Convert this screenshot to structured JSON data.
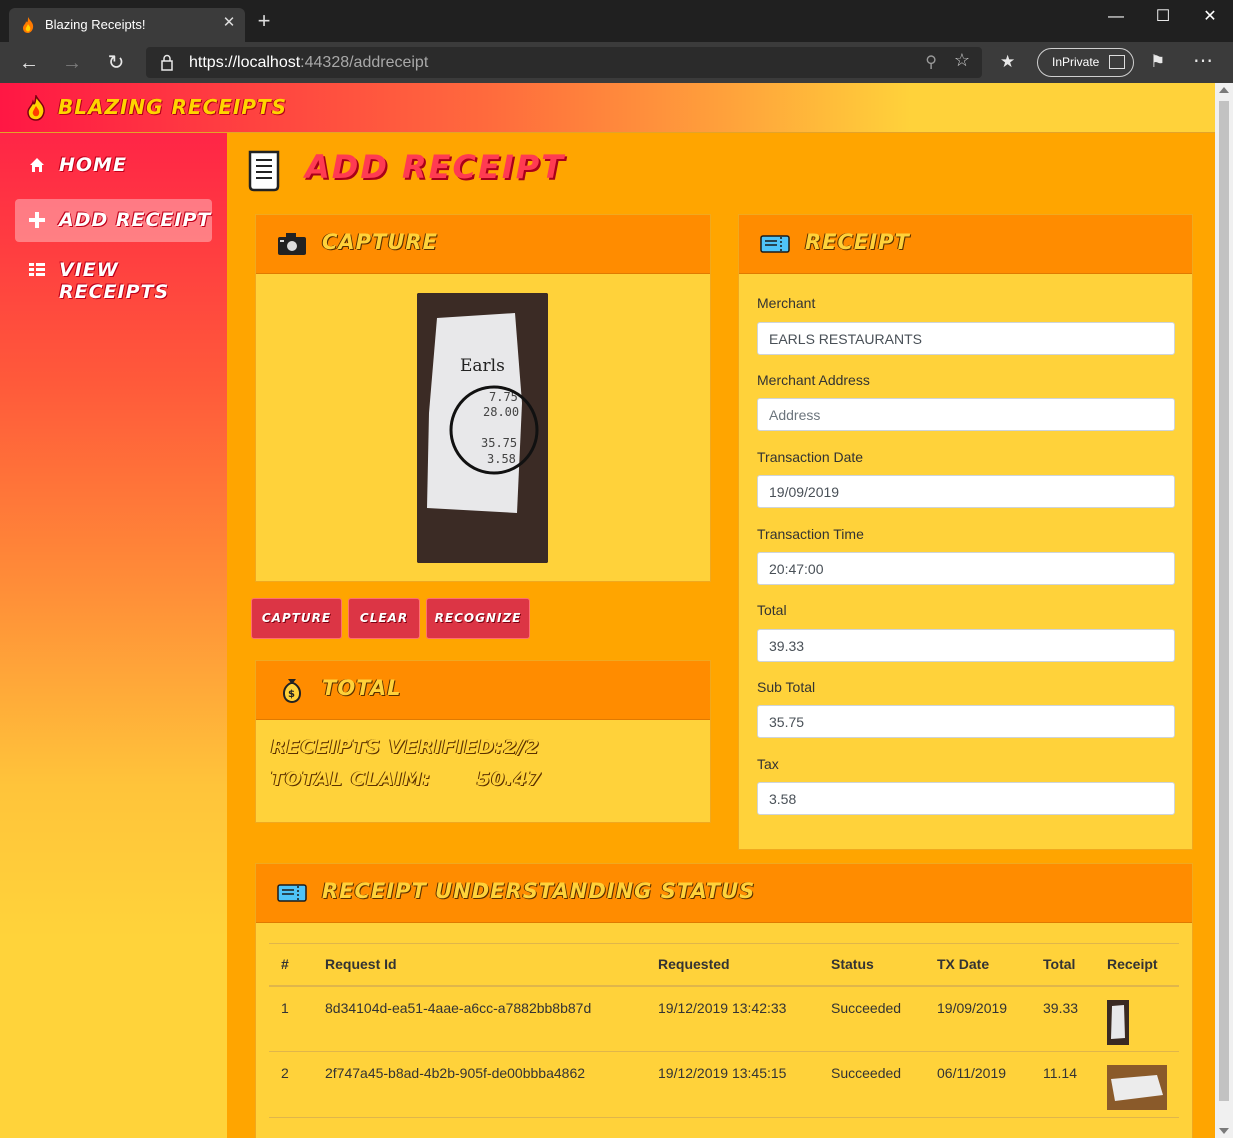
{
  "browser": {
    "tab_title": "Blazing Receipts!",
    "tab_close": "✕",
    "new_tab": "+",
    "url_scheme_host": "https://localhost",
    "url_rest": ":44328/addreceipt",
    "inprivate_label": "InPrivate",
    "window_controls": {
      "minimize": "—",
      "maximize": "☐",
      "close": "✕"
    }
  },
  "app": {
    "brand": "BLAZING RECEIPTS",
    "nav": [
      {
        "label": "HOME",
        "icon": "home-icon"
      },
      {
        "label": "ADD RECEIPT",
        "icon": "plus-icon"
      },
      {
        "label": "VIEW RECEIPTS",
        "icon": "list-icon"
      }
    ]
  },
  "page": {
    "title": "ADD RECEIPT"
  },
  "capture_card": {
    "title": "CAPTURE",
    "icon": "camera-icon",
    "photo_text": {
      "merchant": "Earls",
      "lines": [
        "7.75",
        "28.00",
        "35.75",
        "3.58"
      ]
    },
    "buttons": {
      "capture": "CAPTURE",
      "clear": "CLEAR",
      "recognize": "RECOGNIZE"
    }
  },
  "total_card": {
    "title": "TOTAL",
    "icon": "money-bag-icon",
    "verified_line": "RECEIPTS VERIFIED:2/2",
    "claim_line": "TOTAL CLAIM:      50.47"
  },
  "receipt_card": {
    "title": "RECEIPT",
    "icon": "ticket-icon",
    "fields": {
      "merchant": {
        "label": "Merchant",
        "value": "EARLS RESTAURANTS",
        "placeholder": ""
      },
      "merchant_address": {
        "label": "Merchant Address",
        "value": "",
        "placeholder": "Address"
      },
      "transaction_date": {
        "label": "Transaction Date",
        "value": "19/09/2019"
      },
      "transaction_time": {
        "label": "Transaction Time",
        "value": "20:47:00"
      },
      "total": {
        "label": "Total",
        "value": "39.33"
      },
      "sub_total": {
        "label": "Sub Total",
        "value": "35.75"
      },
      "tax": {
        "label": "Tax",
        "value": "3.58"
      }
    }
  },
  "status_card": {
    "title": "RECEIPT UNDERSTANDING STATUS",
    "icon": "ticket-icon",
    "columns": [
      "#",
      "Request Id",
      "Requested",
      "Status",
      "TX Date",
      "Total",
      "Receipt"
    ],
    "rows": [
      {
        "num": "1",
        "request_id": "8d34104d-ea51-4aae-a6cc-a7882bb8b87d",
        "requested": "19/12/2019 13:42:33",
        "status": "Succeeded",
        "tx_date": "19/09/2019",
        "total": "39.33"
      },
      {
        "num": "2",
        "request_id": "2f747a45-b8ad-4b2b-905f-de00bbba4862",
        "requested": "19/12/2019 13:45:15",
        "status": "Succeeded",
        "tx_date": "06/11/2019",
        "total": "11.14"
      }
    ]
  },
  "colors": {
    "accent_red": "#dc3545",
    "page_orange": "#ffa500",
    "card_yellow": "#ffd23a",
    "card_header_orange": "#ff8c00"
  }
}
